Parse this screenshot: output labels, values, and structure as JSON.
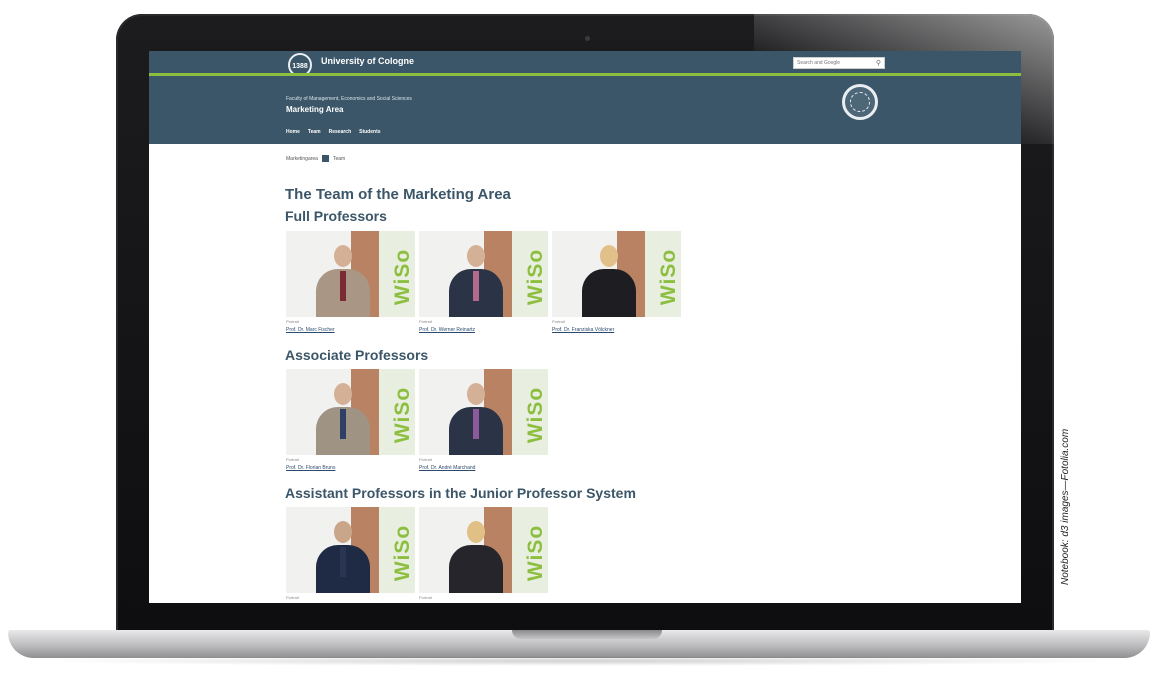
{
  "browser_page": {
    "topbar": {
      "university": "University of Cologne",
      "seal_text": "1388",
      "search_placeholder": "Search and Google"
    },
    "header": {
      "faculty": "Faculty of Management, Economics and Social Sciences",
      "area": "Marketing Area",
      "nav": [
        "Home",
        "Team",
        "Research",
        "Students"
      ]
    },
    "breadcrumb": [
      "Marketingarea",
      "Team"
    ],
    "page_title": "The Team of the Marketing Area",
    "sections": [
      {
        "title": "Full Professors",
        "people": [
          {
            "name": "Prof. Dr. Marc Fischer",
            "photo_caption": "Portrait"
          },
          {
            "name": "Prof. Dr. Werner Reinartz",
            "photo_caption": "Portrait"
          },
          {
            "name": "Prof. Dr. Franziska Völckner",
            "photo_caption": "Portrait"
          }
        ]
      },
      {
        "title": "Associate Professors",
        "people": [
          {
            "name": "Prof. Dr. Florian Bruns",
            "photo_caption": "Portrait"
          },
          {
            "name": "Prof. Dr. André Marchand",
            "photo_caption": "Portrait"
          }
        ]
      },
      {
        "title": "Assistant Professors in the Junior Professor System",
        "people": [
          {
            "name": "",
            "photo_caption": "Portrait"
          },
          {
            "name": "",
            "photo_caption": "Portrait"
          }
        ]
      }
    ],
    "wiso_label": "WiSo"
  },
  "credit": "Notebook: d3 images—Fotolia.com",
  "colors": {
    "header": "#3b5668",
    "accent_green": "#8cbf3f",
    "title": "#3b5668"
  }
}
